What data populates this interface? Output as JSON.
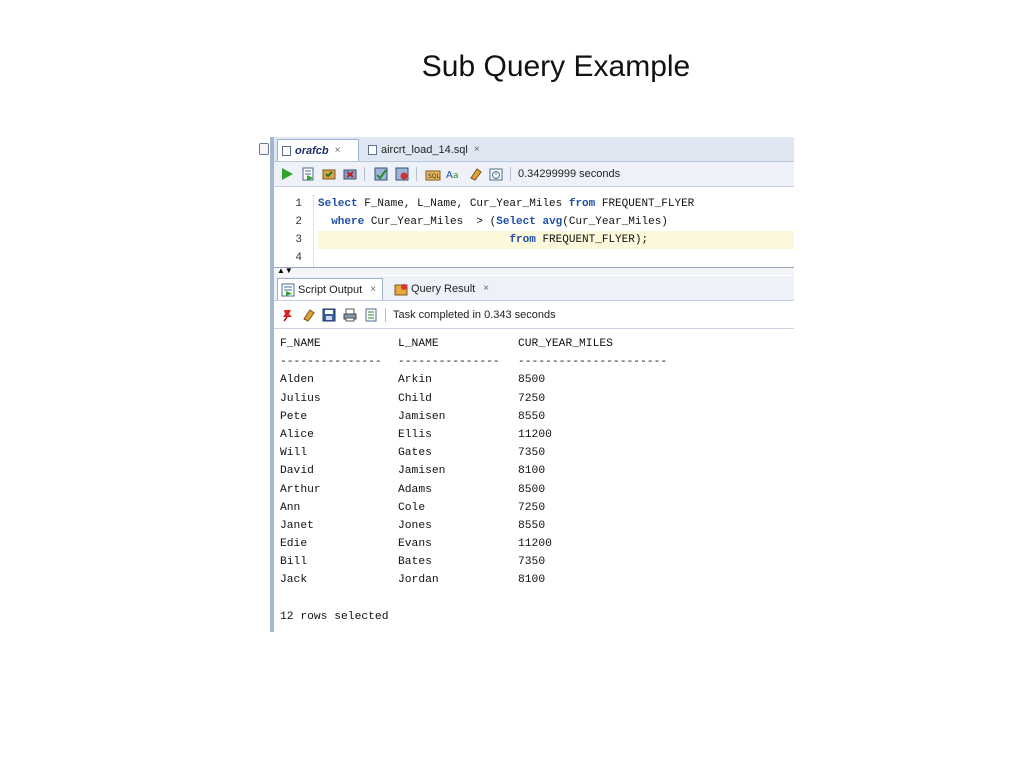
{
  "slide": {
    "title": "Sub Query Example"
  },
  "editor_tabs": [
    {
      "label": "orafcb",
      "close": "×"
    },
    {
      "label": "aircrt_load_14.sql",
      "close": "×"
    }
  ],
  "toolbar": {
    "icons": [
      "run-icon",
      "run-script-icon",
      "commit-icon",
      "rollback-icon",
      "autotrace-icon",
      "explain-icon",
      "sql-tuning-icon",
      "format-icon",
      "eraser-icon",
      "history-icon"
    ],
    "timing": "0.34299999 seconds"
  },
  "editor": {
    "line_numbers": [
      "1",
      "2",
      "3",
      "4"
    ],
    "lines": [
      [
        {
          "t": "Select",
          "k": true
        },
        {
          "t": " F_Name, L_Name, Cur_Year_Miles ",
          "k": false
        },
        {
          "t": "from",
          "k": true
        },
        {
          "t": " FREQUENT_FLYER",
          "k": false
        }
      ],
      [
        {
          "t": "  where",
          "k": true
        },
        {
          "t": " Cur_Year_Miles  > (",
          "k": false
        },
        {
          "t": "Select",
          "k": true
        },
        {
          "t": " ",
          "k": false
        },
        {
          "t": "avg",
          "k": true
        },
        {
          "t": "(Cur_Year_Miles)",
          "k": false
        }
      ],
      [
        {
          "t": "                             ",
          "k": false
        },
        {
          "t": "from",
          "k": true
        },
        {
          "t": " FREQUENT_FLYER);",
          "k": false
        }
      ],
      []
    ]
  },
  "output_tabs": [
    {
      "label": "Script Output",
      "close": "×"
    },
    {
      "label": "Query Result",
      "close": "×"
    }
  ],
  "output_toolbar": {
    "icons": [
      "pin-icon",
      "eraser-icon",
      "save-icon",
      "print-icon",
      "document-icon"
    ],
    "status": "Task completed in 0.343 seconds"
  },
  "result": {
    "columns": [
      "F_NAME",
      "L_NAME",
      "CUR_YEAR_MILES"
    ],
    "underline": [
      "---------------",
      "---------------",
      "----------------------"
    ],
    "rows": [
      [
        "Alden",
        "Arkin",
        "8500"
      ],
      [
        "Julius",
        "Child",
        "7250"
      ],
      [
        "Pete",
        "Jamisen",
        "8550"
      ],
      [
        "Alice",
        "Ellis",
        "11200"
      ],
      [
        "Will",
        "Gates",
        "7350"
      ],
      [
        "David",
        "Jamisen",
        "8100"
      ],
      [
        "Arthur",
        "Adams",
        "8500"
      ],
      [
        "Ann",
        "Cole",
        "7250"
      ],
      [
        "Janet",
        "Jones",
        "8550"
      ],
      [
        "Edie",
        "Evans",
        "11200"
      ],
      [
        "Bill",
        "Bates",
        "7350"
      ],
      [
        "Jack",
        "Jordan",
        "8100"
      ]
    ],
    "footer": "12 rows selected"
  }
}
